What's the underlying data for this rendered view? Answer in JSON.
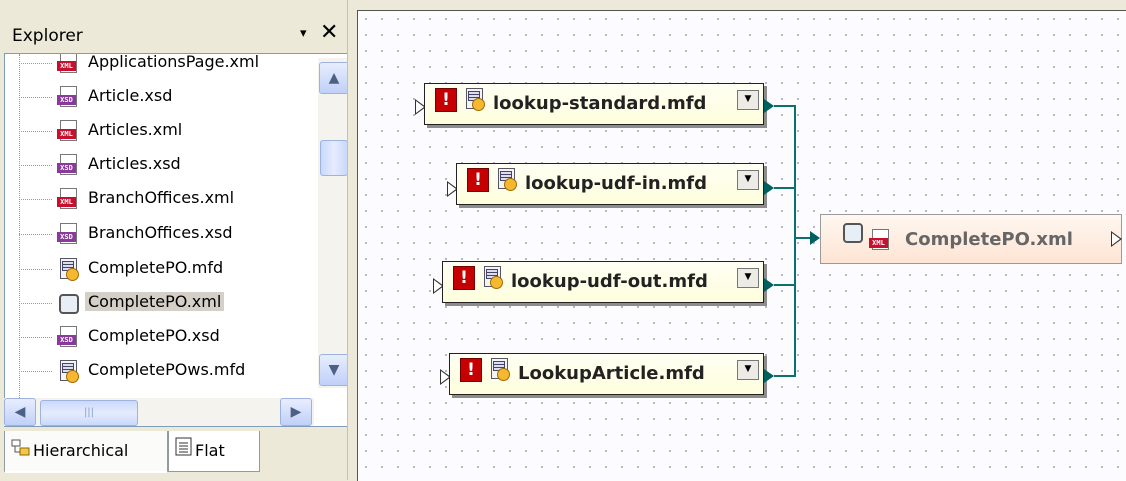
{
  "explorer": {
    "title": "Explorer",
    "pin_icon": "▾",
    "close_icon": "✕",
    "items": [
      {
        "label": "ApplicationsPage.xml",
        "type": "xml"
      },
      {
        "label": "Article.xsd",
        "type": "xsd"
      },
      {
        "label": "Articles.xml",
        "type": "xml"
      },
      {
        "label": "Articles.xsd",
        "type": "xsd"
      },
      {
        "label": "BranchOffices.xml",
        "type": "xml"
      },
      {
        "label": "BranchOffices.xsd",
        "type": "xsd"
      },
      {
        "label": "CompletePO.mfd",
        "type": "mfd"
      },
      {
        "label": "CompletePO.xml",
        "type": "wsdl",
        "selected": true
      },
      {
        "label": "CompletePO.xsd",
        "type": "xsd"
      },
      {
        "label": "CompletePOws.mfd",
        "type": "mfd"
      }
    ],
    "tabs": [
      {
        "label": "Hierarchical",
        "active": true
      },
      {
        "label": "Flat",
        "active": false
      }
    ]
  },
  "canvas": {
    "components": [
      {
        "label": "lookup-standard.mfd"
      },
      {
        "label": "lookup-udf-in.mfd"
      },
      {
        "label": "lookup-udf-out.mfd"
      },
      {
        "label": "LookupArticle.mfd"
      }
    ],
    "target": {
      "label": "CompletePO.xml"
    },
    "dropdown_icon": "▼"
  },
  "colors": {
    "connector": "#0a7070",
    "error_badge": "#c60000",
    "xml_tag": "#c8102e",
    "xsd_tag": "#8a3a9a"
  }
}
